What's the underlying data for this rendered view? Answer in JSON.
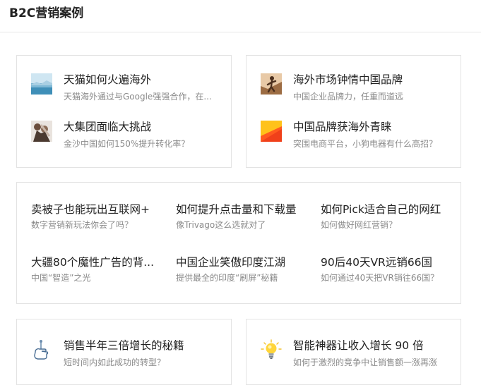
{
  "section_title": "B2C营销案例",
  "card_top_left": [
    {
      "title": "天猫如何火遍海外",
      "subtitle": "天猫海外通过与Google强强合作，在...",
      "icon": "landscape-photo-icon"
    },
    {
      "title": "大集团面临大挑战",
      "subtitle": "金沙中国如何150%提升转化率？",
      "icon": "crowd-photo-icon"
    }
  ],
  "card_top_right": [
    {
      "title": "海外市场钟情中国品牌",
      "subtitle": "中国企业品牌力，任重而道远",
      "icon": "climber-photo-icon"
    },
    {
      "title": "中国品牌获海外青睐",
      "subtitle": "突围电商平台，小狗电器有什么高招？",
      "icon": "orange-red-graphic-icon"
    }
  ],
  "card_middle": [
    {
      "title": "卖被子也能玩出互联网+",
      "subtitle": "数字营销新玩法你会了吗？"
    },
    {
      "title": "如何提升点击量和下载量",
      "subtitle": "像Trivago这么选就对了"
    },
    {
      "title": "如何Pick适合自己的网红",
      "subtitle": "如何做好网红营销？"
    },
    {
      "title": "大疆80个魔性广告的背...",
      "subtitle": "中国“智造”之光"
    },
    {
      "title": "中国企业笑傲印度江湖",
      "subtitle": "提供最全的印度“刷屏”秘籍"
    },
    {
      "title": "90后40天VR远销66国",
      "subtitle": "如何通过40天把VR销往66国？"
    }
  ],
  "card_bottom_left": [
    {
      "title": "销售半年三倍增长的秘籍",
      "subtitle": "短时间内如此成功的转型？",
      "icon": "hand-lever-icon"
    }
  ],
  "card_bottom_right": [
    {
      "title": "智能神器让收入增长 90 倍",
      "subtitle": "如何于激烈的竞争中让销售额一涨再涨",
      "icon": "lightbulb-icon"
    }
  ]
}
